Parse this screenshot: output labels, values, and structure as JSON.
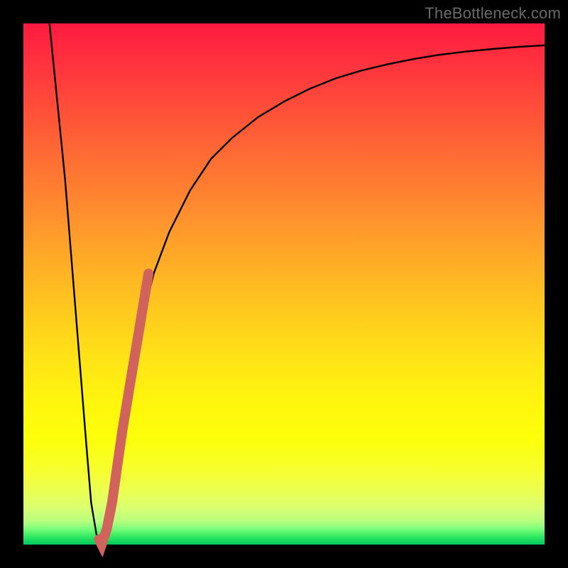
{
  "watermark": "TheBottleneck.com",
  "chart_data": {
    "type": "line",
    "title": "",
    "xlabel": "",
    "ylabel": "",
    "xlim": [
      0,
      100
    ],
    "ylim": [
      0,
      100
    ],
    "series": [
      {
        "name": "bottleneck-curve",
        "x": [
          5,
          8,
          10,
          12,
          13,
          14,
          15,
          16,
          18,
          20,
          22,
          25,
          28,
          32,
          36,
          40,
          45,
          50,
          55,
          60,
          65,
          70,
          75,
          80,
          85,
          90,
          95,
          100
        ],
        "y": [
          100,
          70,
          45,
          20,
          8,
          2,
          0,
          3,
          15,
          28,
          40,
          52,
          60,
          68,
          74,
          78,
          82,
          85,
          87.5,
          89.5,
          91,
          92.2,
          93.2,
          94,
          94.6,
          95.1,
          95.5,
          95.8
        ]
      }
    ],
    "highlight_segment": {
      "name": "overlay-marker",
      "color": "#d1635d",
      "x": [
        14.5,
        15,
        16,
        17,
        18,
        19,
        20,
        21,
        22,
        23,
        24
      ],
      "y": [
        1,
        0,
        3,
        8,
        15,
        22,
        28,
        34,
        40,
        46,
        52
      ]
    },
    "gradient_stops": [
      {
        "pos": 0.0,
        "color": "#ff1a40"
      },
      {
        "pos": 0.4,
        "color": "#ff9a2c"
      },
      {
        "pos": 0.72,
        "color": "#fff40e"
      },
      {
        "pos": 0.95,
        "color": "#b8ff80"
      },
      {
        "pos": 1.0,
        "color": "#00c95c"
      }
    ]
  }
}
